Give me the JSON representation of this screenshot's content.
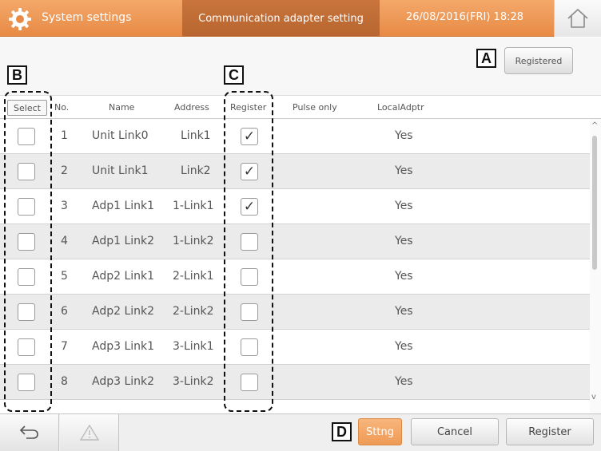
{
  "header": {
    "app_title": "System settings",
    "screen_title": "Communication adapter setting",
    "datetime": "26/08/2016(FRI) 18:28",
    "icons": {
      "settings": "gear-icon",
      "home": "home-icon"
    },
    "accent_color": "#e88a45"
  },
  "top": {
    "registered_label": "Registered",
    "callouts": {
      "a": "A",
      "b": "B",
      "c": "C",
      "d": "D"
    }
  },
  "columns": {
    "select": "Select",
    "no": "No.",
    "name": "Name",
    "address": "Address",
    "register": "Register",
    "pulse_only": "Pulse only",
    "local_adptr": "LocalAdptr"
  },
  "rows": [
    {
      "no": "1",
      "name": "Unit Link0",
      "address": "Link1",
      "selected": false,
      "registered": true,
      "pulse_only": "",
      "local_adptr": "Yes"
    },
    {
      "no": "2",
      "name": "Unit Link1",
      "address": "Link2",
      "selected": false,
      "registered": true,
      "pulse_only": "",
      "local_adptr": "Yes"
    },
    {
      "no": "3",
      "name": "Adp1 Link1",
      "address": "1-Link1",
      "selected": false,
      "registered": true,
      "pulse_only": "",
      "local_adptr": "Yes"
    },
    {
      "no": "4",
      "name": "Adp1 Link2",
      "address": "1-Link2",
      "selected": false,
      "registered": false,
      "pulse_only": "",
      "local_adptr": "Yes"
    },
    {
      "no": "5",
      "name": "Adp2 Link1",
      "address": "2-Link1",
      "selected": false,
      "registered": false,
      "pulse_only": "",
      "local_adptr": "Yes"
    },
    {
      "no": "6",
      "name": "Adp2 Link2",
      "address": "2-Link2",
      "selected": false,
      "registered": false,
      "pulse_only": "",
      "local_adptr": "Yes"
    },
    {
      "no": "7",
      "name": "Adp3 Link1",
      "address": "3-Link1",
      "selected": false,
      "registered": false,
      "pulse_only": "",
      "local_adptr": "Yes"
    },
    {
      "no": "8",
      "name": "Adp3 Link2",
      "address": "3-Link2",
      "selected": false,
      "registered": false,
      "pulse_only": "",
      "local_adptr": "Yes"
    }
  ],
  "bottom": {
    "sttng_label": "Sttng",
    "cancel_label": "Cancel",
    "register_label": "Register",
    "icons": {
      "back": "back-arrow-icon",
      "warning": "warning-icon"
    },
    "sttng_color": "#ef9a56"
  },
  "check_glyph": "✓"
}
